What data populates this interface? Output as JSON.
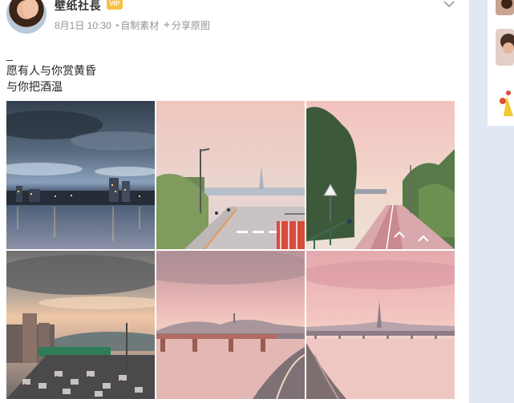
{
  "post": {
    "username": "壁纸社長",
    "badge": "VIP",
    "date": "8月1日 10:30",
    "source_label": "自制素材",
    "share_label": "分享原图",
    "text_lines": [
      "_",
      "愿有人与你赏黄昏",
      "与你把酒温"
    ]
  },
  "icons": {
    "chevron": "chevron-down-icon",
    "source": "triangle-right-icon",
    "share": "plus-icon"
  },
  "photos": [
    {
      "label": "city-night-skyline"
    },
    {
      "label": "riverside-bike-path-tower"
    },
    {
      "label": "trees-bike-path-sunset"
    },
    {
      "label": "highway-traffic-dusk"
    },
    {
      "label": "bridge-river-pink-sky"
    },
    {
      "label": "river-tower-pink-sky"
    }
  ],
  "colors": {
    "background": "#dfe8f3",
    "card": "#ffffff",
    "meta_text": "#939393"
  }
}
